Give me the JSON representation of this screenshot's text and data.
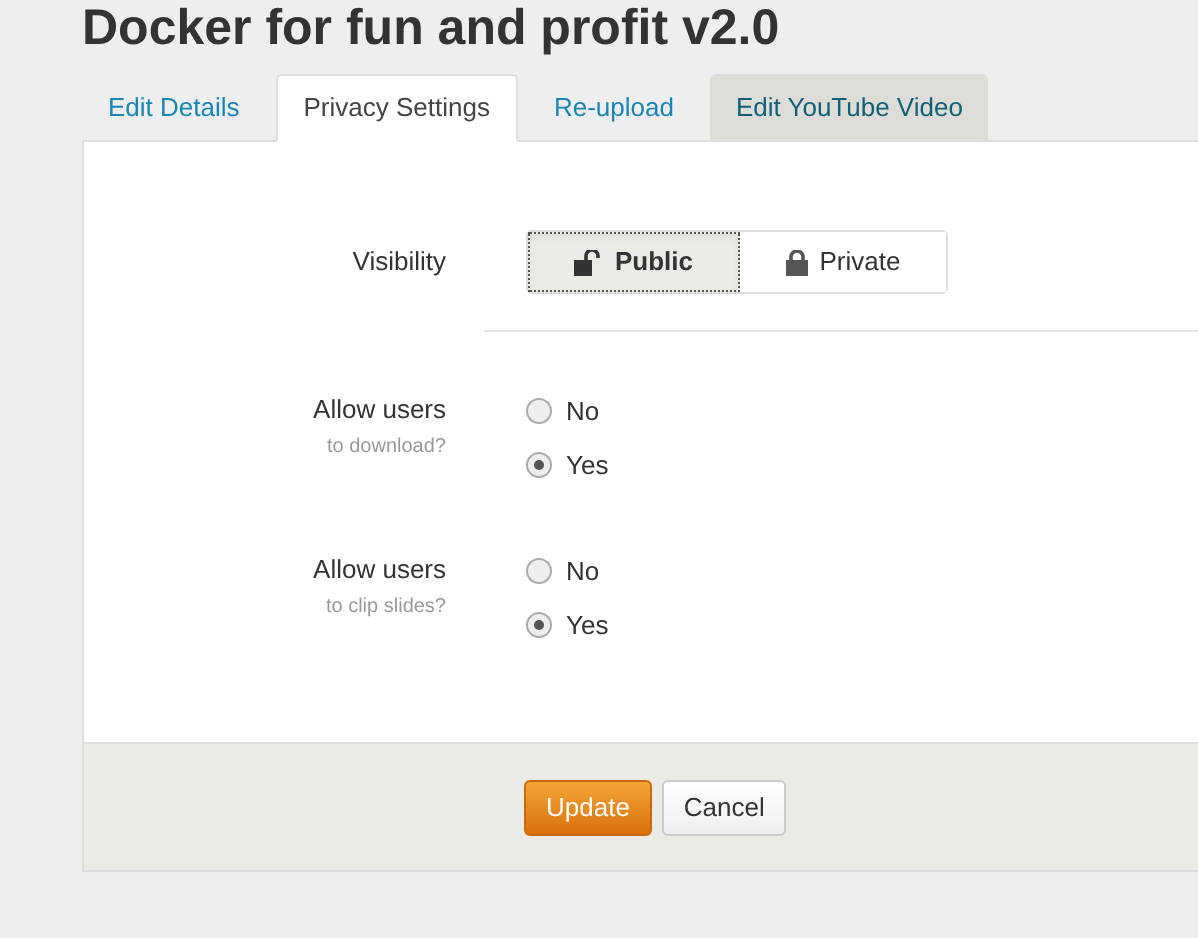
{
  "title": "Docker for fun and profit v2.0",
  "tabs": [
    {
      "label": "Edit Details",
      "selected": false,
      "kind": "normal"
    },
    {
      "label": "Privacy Settings",
      "selected": true,
      "kind": "normal"
    },
    {
      "label": "Re-upload",
      "selected": false,
      "kind": "normal"
    },
    {
      "label": "Edit YouTube Video",
      "selected": false,
      "kind": "shaded"
    }
  ],
  "visibility": {
    "label": "Visibility",
    "options": [
      {
        "label": "Public",
        "selected": true,
        "kind": "unlocked"
      },
      {
        "label": "Private",
        "selected": false,
        "kind": "locked"
      }
    ]
  },
  "questions": [
    {
      "label": "Allow users",
      "hint": "to download?",
      "options": [
        {
          "label": "No",
          "selected": false
        },
        {
          "label": "Yes",
          "selected": true
        }
      ]
    },
    {
      "label": "Allow users",
      "hint": "to clip slides?",
      "options": [
        {
          "label": "No",
          "selected": false
        },
        {
          "label": "Yes",
          "selected": true
        }
      ]
    }
  ],
  "buttons": [
    {
      "label": "Update",
      "kind": "primary"
    },
    {
      "label": "Cancel",
      "kind": "secondary"
    }
  ]
}
